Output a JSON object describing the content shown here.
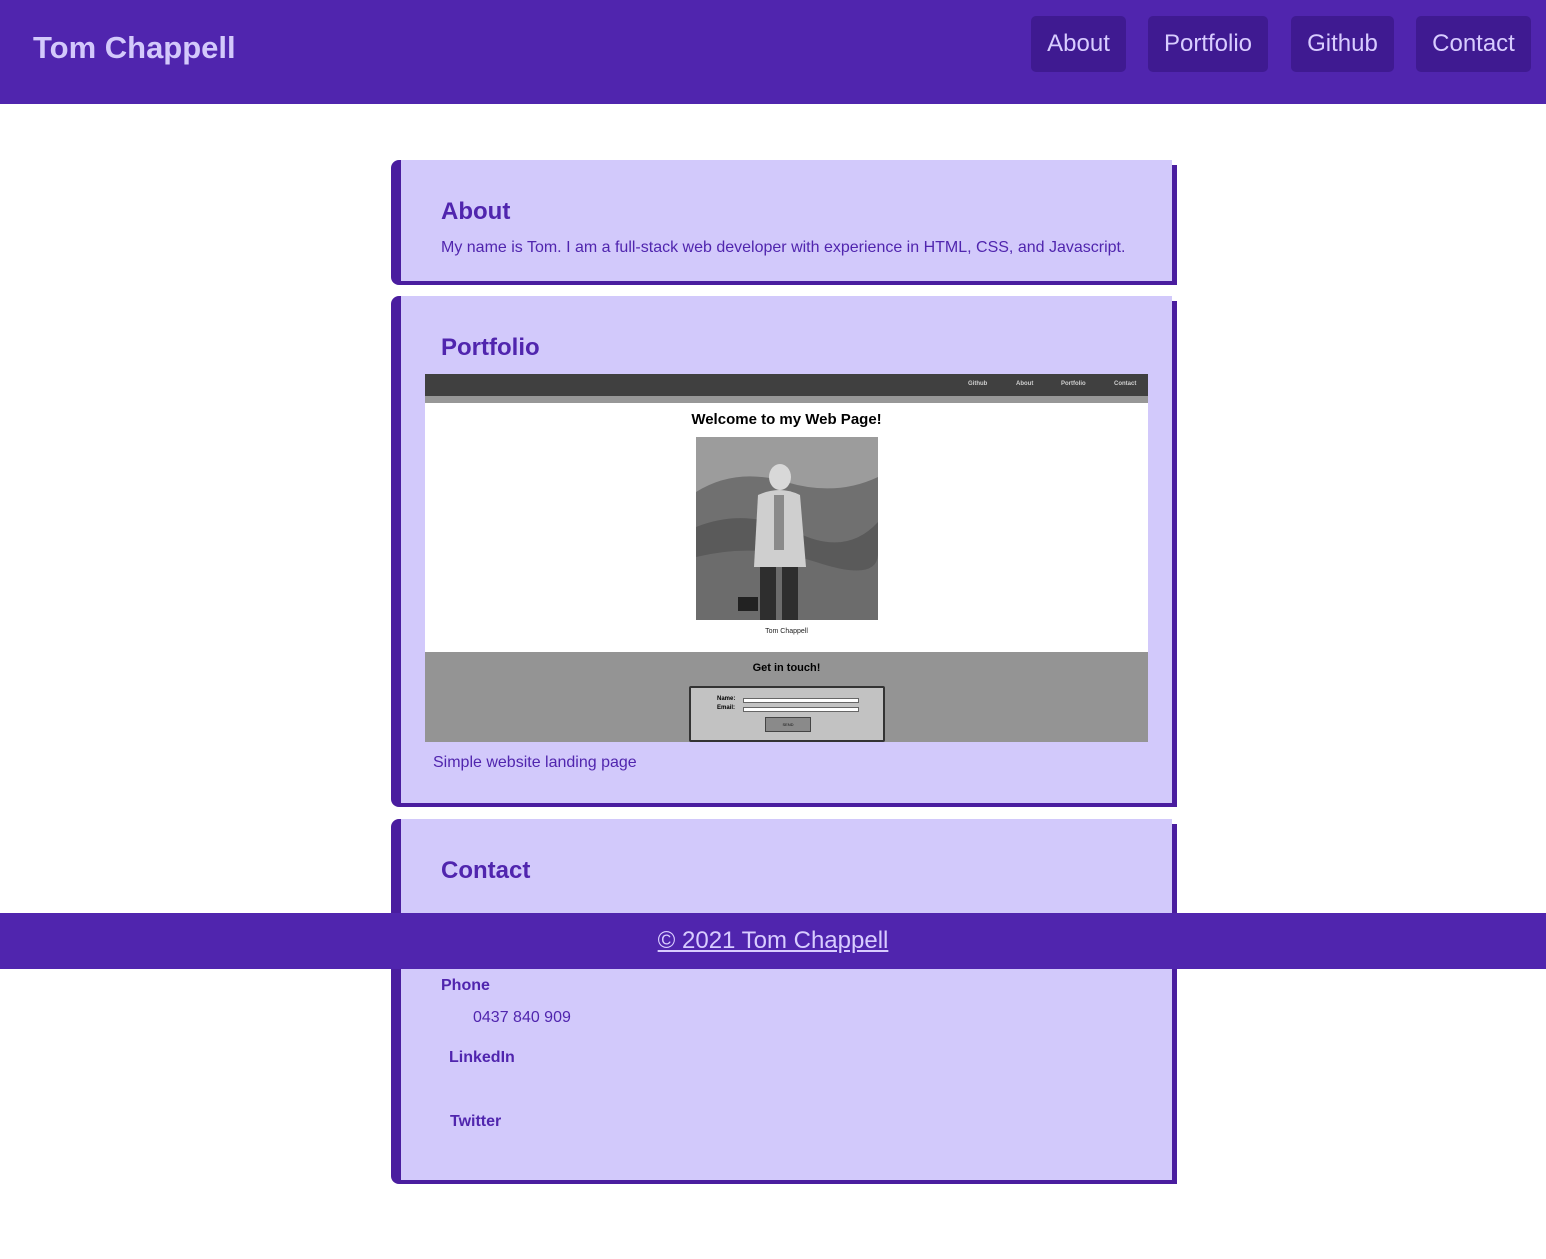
{
  "header": {
    "title": "Tom Chappell",
    "nav": [
      {
        "label": "About"
      },
      {
        "label": "Portfolio"
      },
      {
        "label": "Github"
      },
      {
        "label": "Contact"
      }
    ]
  },
  "about": {
    "title": "About",
    "text": "My name is Tom. I am a full-stack web developer with experience in HTML, CSS, and Javascript."
  },
  "portfolio": {
    "title": "Portfolio",
    "item_caption": "Simple website landing page",
    "screenshot": {
      "nav": [
        "Github",
        "About",
        "Portfolio",
        "Contact"
      ],
      "heading": "Welcome to my Web Page!",
      "photo_caption": "Tom Chappell",
      "footer_title": "Get in touch!",
      "name_label": "Name:",
      "email_label": "Email:",
      "send_label": "SEND"
    }
  },
  "contact": {
    "title": "Contact",
    "phone_label": "Phone",
    "phone_value": "0437 840 909",
    "linkedin_label": "LinkedIn",
    "twitter_label": "Twitter"
  },
  "footer": {
    "text": "© 2021 Tom Chappell"
  },
  "colors": {
    "brand": "#5025ae",
    "card_bg": "#d2c9fb",
    "nav_button": "#3f1a91"
  }
}
